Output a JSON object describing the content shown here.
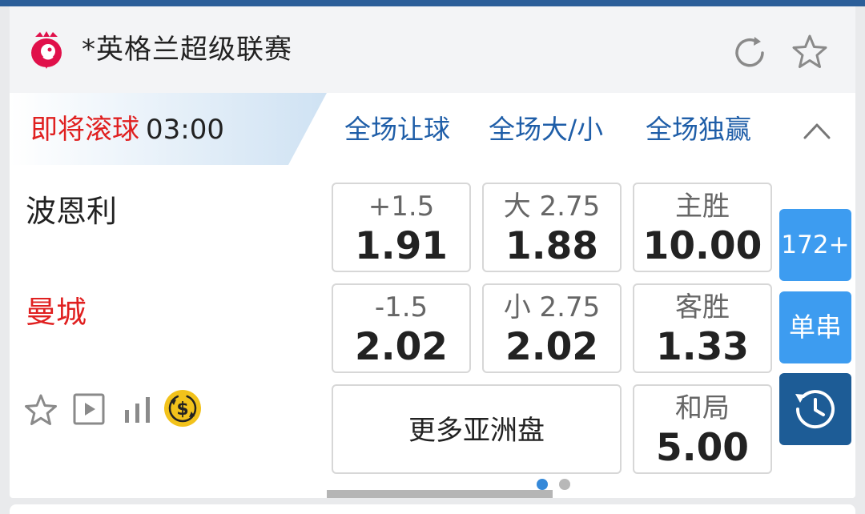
{
  "league": {
    "name": "*英格兰超级联赛",
    "logo_icon": "lion-crest-icon",
    "refresh_icon": "refresh-icon",
    "favorite_icon": "star-outline-icon"
  },
  "match_status": {
    "status": "即将滚球",
    "time": "03:00"
  },
  "market_tabs": [
    {
      "label": "全场让球"
    },
    {
      "label": "全场大/小"
    },
    {
      "label": "全场独赢"
    }
  ],
  "teams": {
    "home": "波恩利",
    "away": "曼城"
  },
  "odds": {
    "handicap_home": {
      "label": "+1.5",
      "value": "1.91"
    },
    "handicap_away": {
      "label": "-1.5",
      "value": "2.02"
    },
    "over": {
      "label": "大 2.75",
      "value": "1.88"
    },
    "under": {
      "label": "小 2.75",
      "value": "2.02"
    },
    "home_win": {
      "label": "主胜",
      "value": "10.00"
    },
    "away_win": {
      "label": "客胜",
      "value": "1.33"
    },
    "draw": {
      "label": "和局",
      "value": "5.00"
    }
  },
  "more_asian_label": "更多亚洲盘",
  "side_buttons": {
    "more_markets": "172+",
    "single_parlay": "单串",
    "history_icon": "clock-history-icon"
  },
  "utility_icons": [
    "star-outline-icon",
    "video-play-icon",
    "stats-bars-icon",
    "cash-out-icon"
  ],
  "pagination": {
    "current_page": 1,
    "total_pages": 2
  },
  "colors": {
    "header_bar": "#2b5e99",
    "live_red": "#e02020",
    "tab_blue": "#1f5ea8",
    "side_button_blue": "#3d9cf0",
    "history_button_navy": "#1d5c96",
    "logo_magenta": "#e0104a",
    "cash_out_yellow": "#f2c21b"
  }
}
